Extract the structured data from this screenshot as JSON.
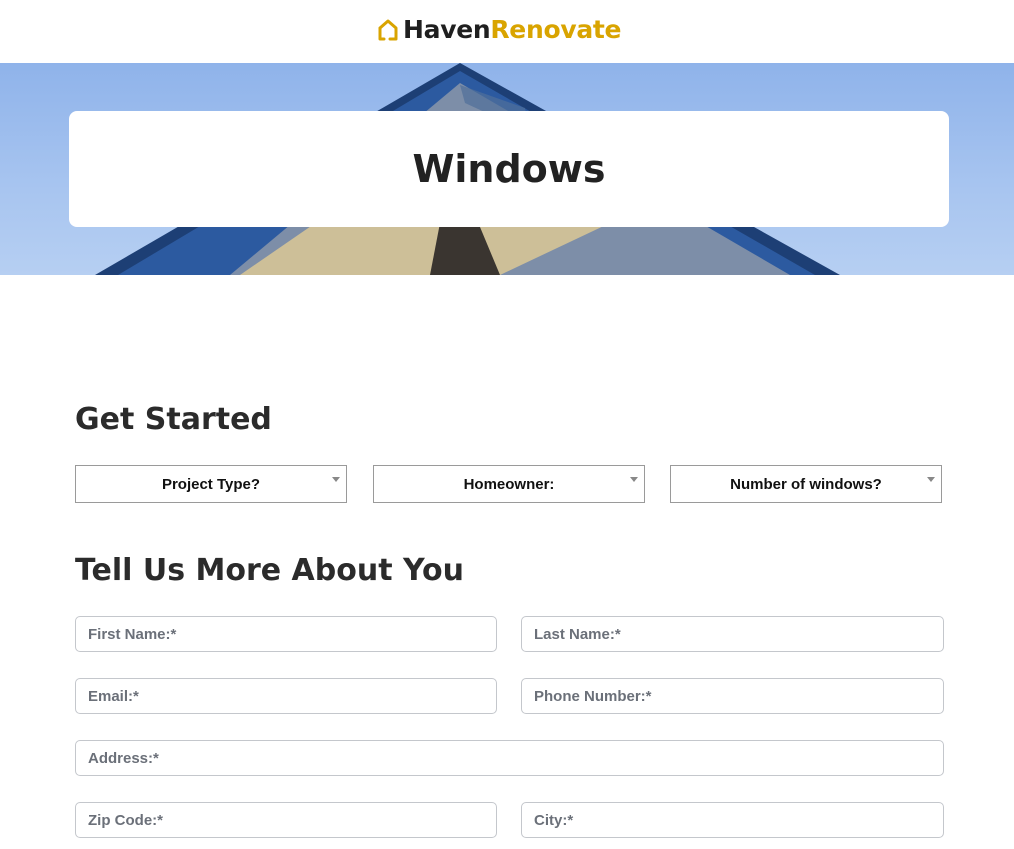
{
  "brand": {
    "name_part1": "Haven",
    "name_part2": "Renovate",
    "icon": "house-icon",
    "accent": "#d9a400"
  },
  "hero": {
    "title": "Windows"
  },
  "get_started": {
    "title": "Get Started",
    "selects": [
      {
        "label": "Project Type?"
      },
      {
        "label": "Homeowner:"
      },
      {
        "label": "Number of windows?"
      }
    ]
  },
  "about": {
    "title": "Tell Us More About You",
    "fields": {
      "first_name": "First Name:*",
      "last_name": "Last Name:*",
      "email": "Email:*",
      "phone": "Phone Number:*",
      "address": "Address:*",
      "zip": "Zip Code:*",
      "city": "City:*"
    }
  }
}
